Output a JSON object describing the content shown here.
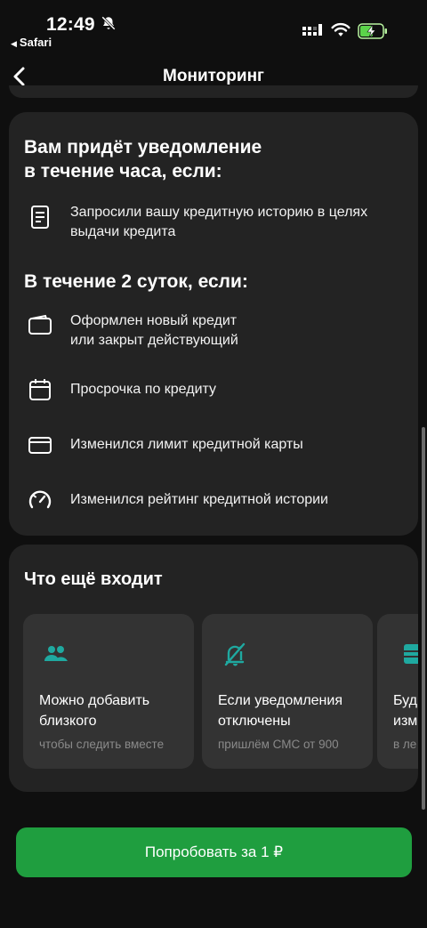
{
  "status_bar": {
    "time": "12:49",
    "back_app": "Safari",
    "icons": [
      "bell-off-icon",
      "signal-icon",
      "wifi-icon",
      "battery-charging-icon"
    ]
  },
  "nav": {
    "title": "Мониторинг",
    "back_icon": "chevron-left-icon"
  },
  "notifications_card": {
    "hour_heading": "Вам придёт уведомление\nв течение часа, если:",
    "hour_items": [
      {
        "icon": "document-icon",
        "text": "Запросили вашу кредитную историю в целях\nвыдачи кредита"
      }
    ],
    "days_heading": "В течение 2 суток, если:",
    "days_items": [
      {
        "icon": "wallet-icon",
        "text": "Оформлен новый кредит\nили закрыт действующий"
      },
      {
        "icon": "calendar-icon",
        "text": "Просрочка по кредиту"
      },
      {
        "icon": "credit-card-icon",
        "text": "Изменился лимит кредитной карты"
      },
      {
        "icon": "gauge-icon",
        "text": "Изменился рейтинг кредитной истории"
      }
    ]
  },
  "included_card": {
    "heading": "Что ещё входит",
    "tiles": [
      {
        "icon": "people-icon",
        "title": "Можно добавить\nблизкого",
        "subtitle": "чтобы следить вместе"
      },
      {
        "icon": "notification-off-icon",
        "title": "Если уведомления\nотключены",
        "subtitle": "пришлём СМС от 900"
      },
      {
        "icon": "device-icon",
        "title": "Буд\nизм",
        "subtitle": "в ле"
      }
    ]
  },
  "colors": {
    "background": "#0f0f0f",
    "card": "#232323",
    "tile": "#333333",
    "accent_green": "#1f9e3f",
    "icon_teal": "#1fa9a0"
  },
  "cta": {
    "label": "Попробовать за 1 ₽"
  }
}
